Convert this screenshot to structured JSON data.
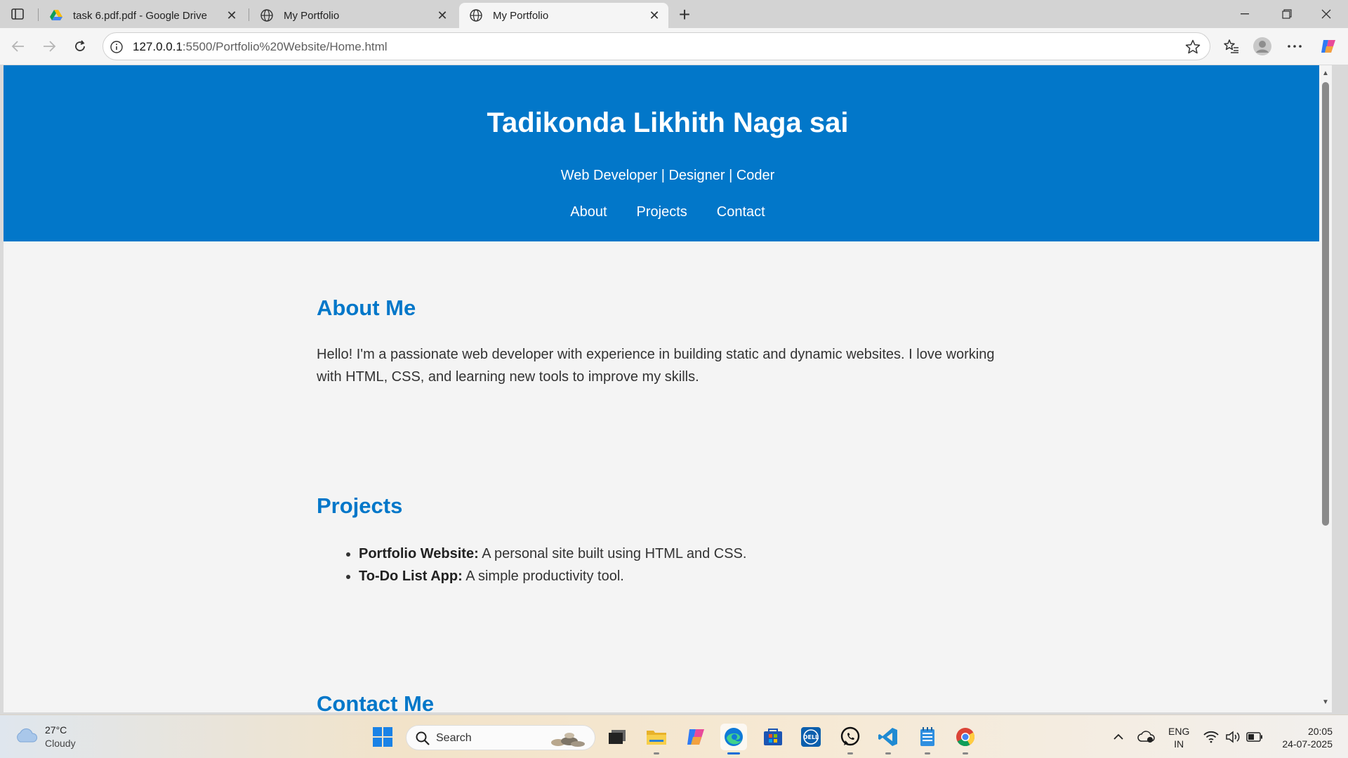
{
  "browser": {
    "tabs": [
      {
        "title": "task 6.pdf.pdf - Google Drive",
        "icon": "google-drive-icon",
        "active": false
      },
      {
        "title": "My Portfolio",
        "icon": "globe-icon",
        "active": false
      },
      {
        "title": "My Portfolio",
        "icon": "globe-icon",
        "active": true
      }
    ],
    "url_host": "127.0.0.1",
    "url_path": ":5500/Portfolio%20Website/Home.html"
  },
  "site": {
    "title": "Tadikonda Likhith Naga sai",
    "subtitle": "Web Developer | Designer | Coder",
    "nav": [
      "About",
      "Projects",
      "Contact"
    ],
    "header_color": "#0277c9"
  },
  "about": {
    "heading": "About Me",
    "text": "Hello! I'm a passionate web developer with experience in building static and dynamic websites. I love working with HTML, CSS, and learning new tools to improve my skills."
  },
  "projects": {
    "heading": "Projects",
    "items": [
      {
        "name": "Portfolio Website:",
        "desc": " A personal site built using HTML and CSS."
      },
      {
        "name": "To-Do List App:",
        "desc": " A simple productivity tool."
      }
    ]
  },
  "contact": {
    "heading": "Contact Me"
  },
  "taskbar": {
    "weather_temp": "27°C",
    "weather_cond": "Cloudy",
    "search_label": "Search",
    "lang_top": "ENG",
    "lang_bottom": "IN",
    "time": "20:05",
    "date": "24-07-2025"
  }
}
